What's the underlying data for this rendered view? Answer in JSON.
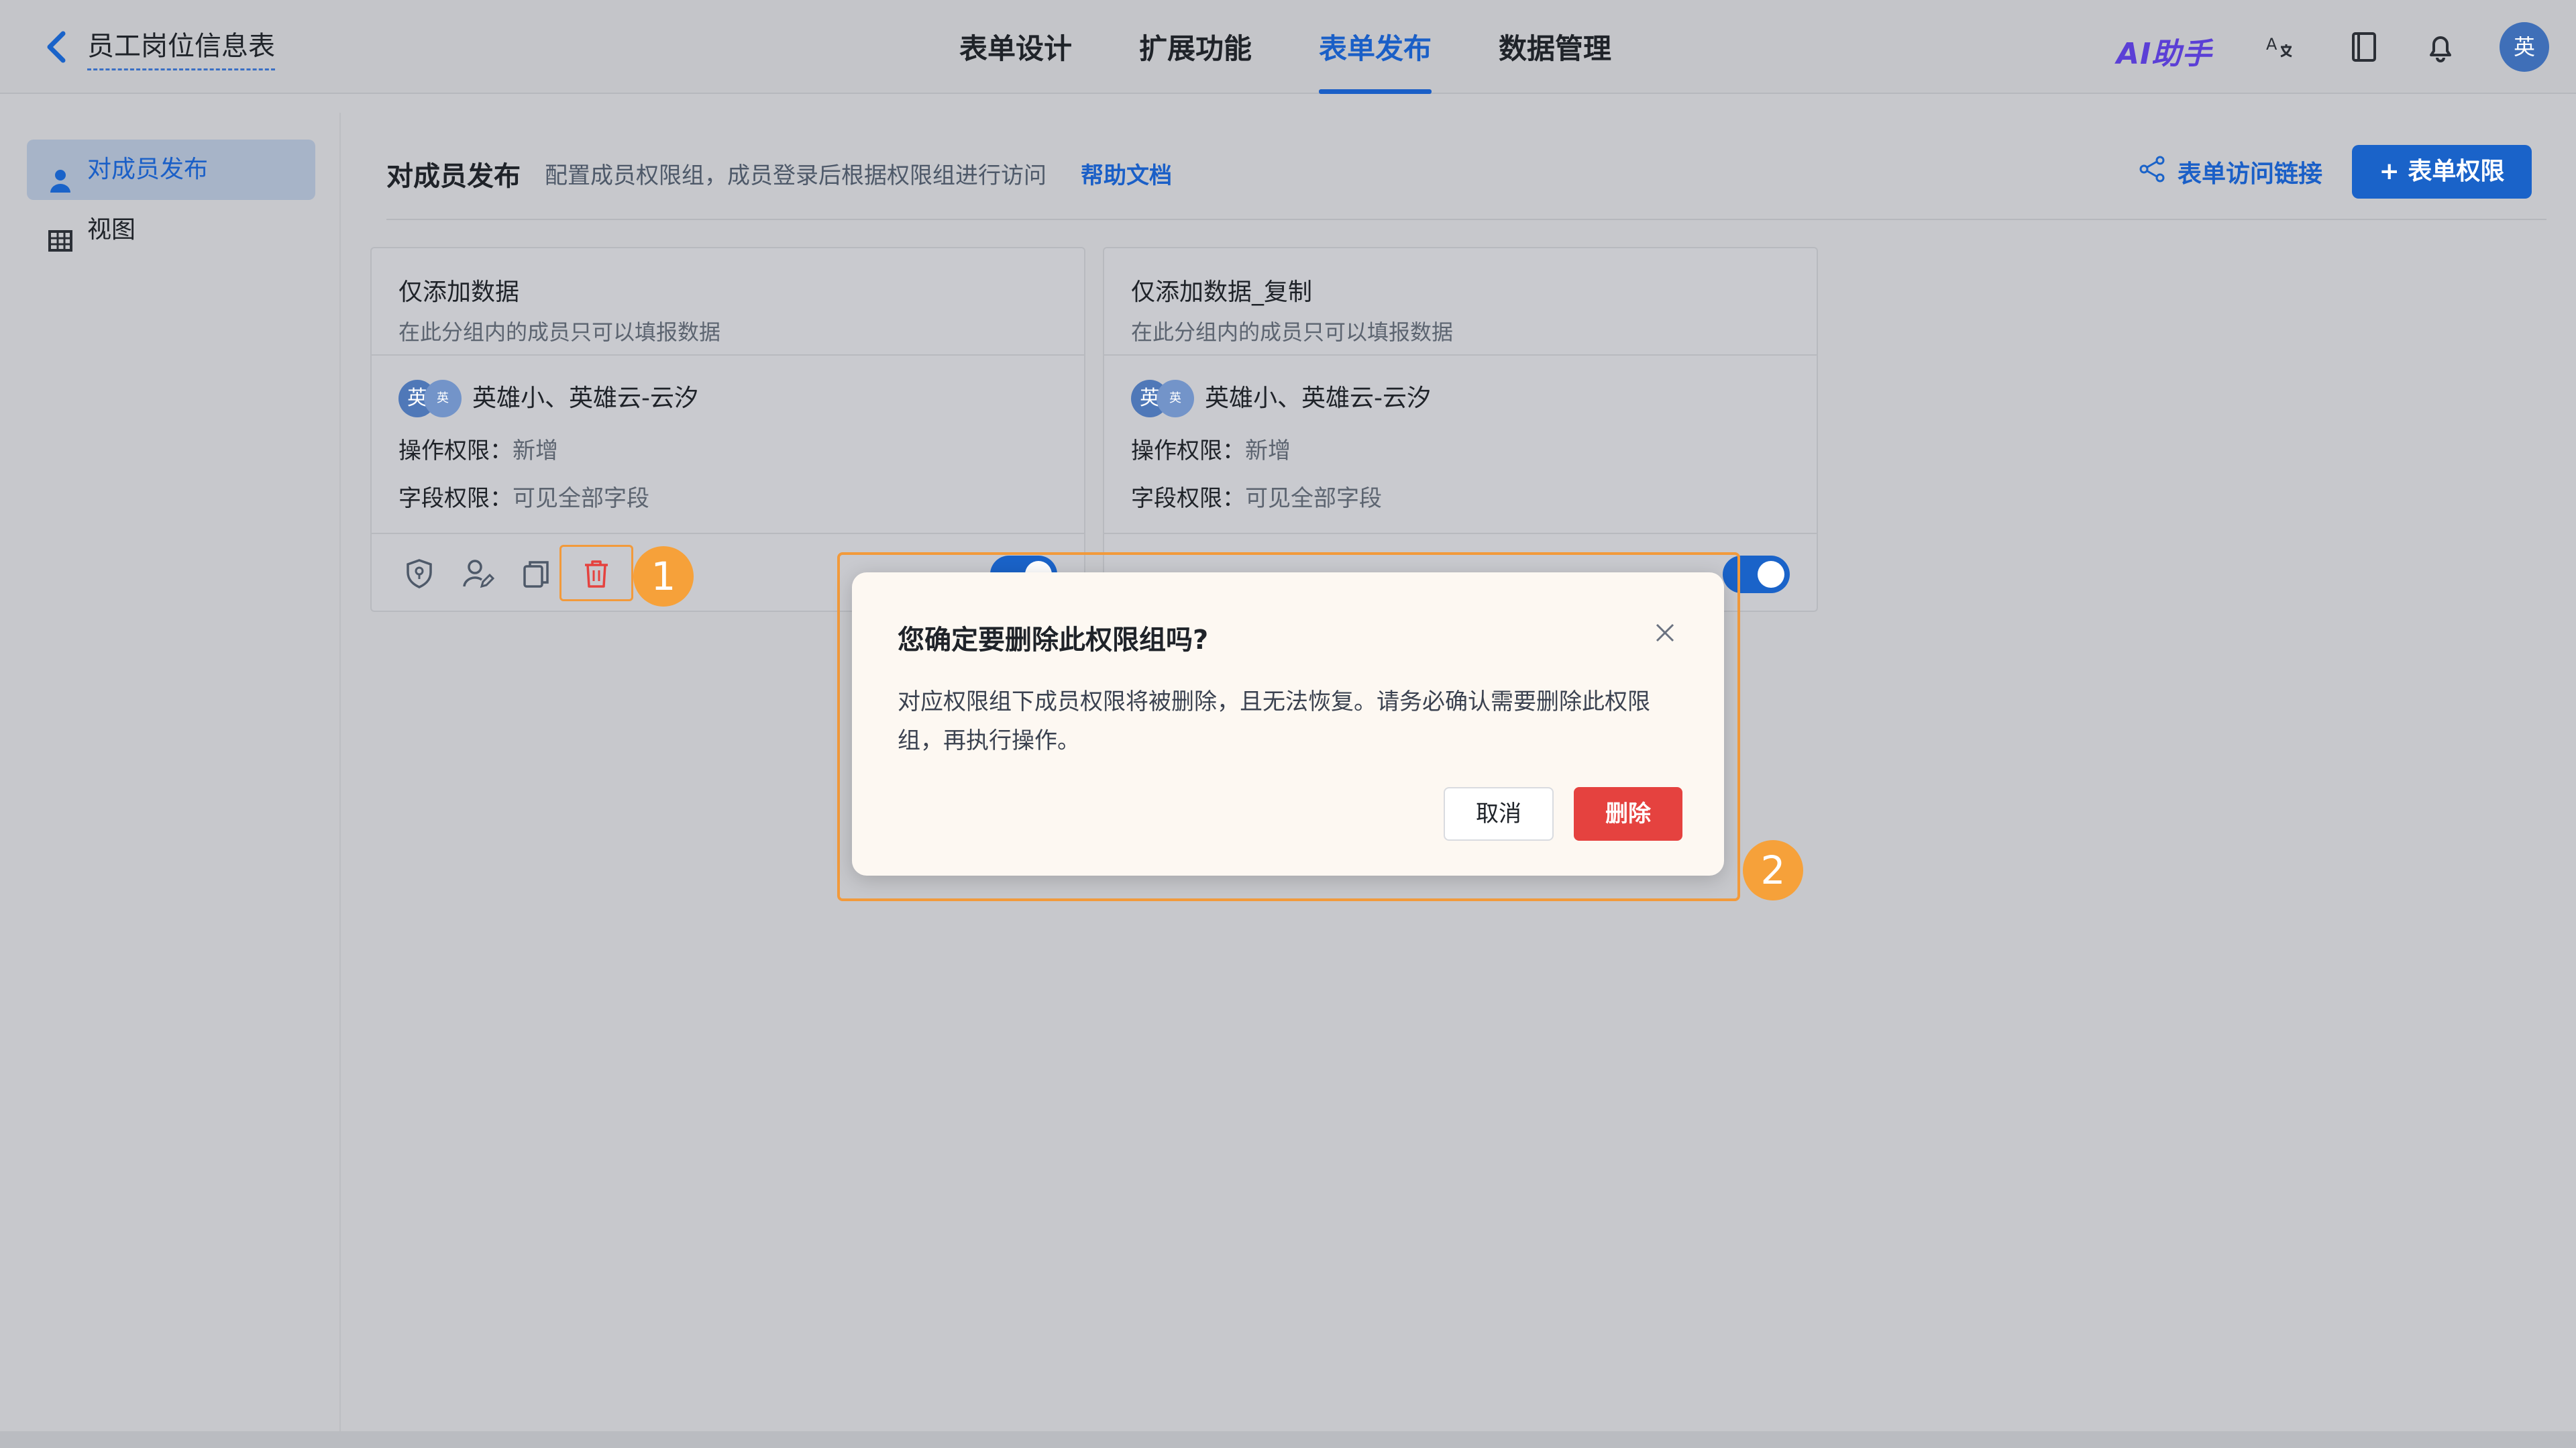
{
  "header": {
    "form_title": "员工岗位信息表",
    "tabs": [
      {
        "label": "表单设计",
        "active": false
      },
      {
        "label": "扩展功能",
        "active": false
      },
      {
        "label": "表单发布",
        "active": true
      },
      {
        "label": "数据管理",
        "active": false
      }
    ],
    "ai_assistant": "AI助手",
    "icons": [
      "translate-icon",
      "book-icon",
      "bell-icon"
    ],
    "avatar_text": "英"
  },
  "sidebar": {
    "items": [
      {
        "label": "对成员发布",
        "icon": "user-icon",
        "active": true
      },
      {
        "label": "视图",
        "icon": "table-icon",
        "active": false
      }
    ]
  },
  "main": {
    "title": "对成员发布",
    "description": "配置成员权限组，成员登录后根据权限组进行访问",
    "help_link": "帮助文档",
    "access_link": "表单访问链接",
    "add_permission_button": "+ 表单权限"
  },
  "cards": [
    {
      "title": "仅添加数据",
      "subtitle": "在此分组内的成员只可以填报数据",
      "members": "英雄小、英雄云-云汐",
      "avatar_main": "英",
      "avatar_small": "英",
      "op_label": "操作权限：",
      "op_value": "新增",
      "field_label": "字段权限：",
      "field_value": "可见全部字段",
      "enabled": true
    },
    {
      "title": "仅添加数据_复制",
      "subtitle": "在此分组内的成员只可以填报数据",
      "members": "英雄小、英雄云-云汐",
      "avatar_main": "英",
      "avatar_small": "英",
      "op_label": "操作权限：",
      "op_value": "新增",
      "field_label": "字段权限：",
      "field_value": "可见全部字段",
      "enabled": true
    }
  ],
  "step_badges": [
    "1",
    "2"
  ],
  "dialog": {
    "title": "您确定要删除此权限组吗?",
    "message": "对应权限组下成员权限将被删除，且无法恢复。请务必确认需要删除此权限组，再执行操作。",
    "cancel_label": "取消",
    "delete_label": "删除"
  },
  "colors": {
    "accent": "#1a63c9",
    "danger": "#e5423f",
    "highlight": "#f29a3b",
    "ai": "#5b3fd6"
  }
}
